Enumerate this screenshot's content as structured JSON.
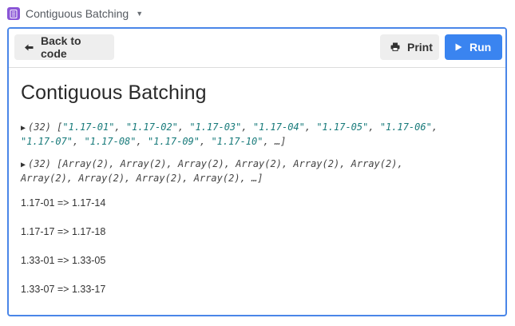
{
  "window": {
    "title": "Contiguous Batching",
    "accent": "#8a55d6"
  },
  "toolbar": {
    "back_label": "Back to code",
    "print_label": "Print",
    "run_label": "Run",
    "run_color": "#3a84f0"
  },
  "page": {
    "title": "Contiguous Batching"
  },
  "outputs": [
    {
      "count": "(32)",
      "items": [
        "\"1.17-01\"",
        "\"1.17-02\"",
        "\"1.17-03\"",
        "\"1.17-04\"",
        "\"1.17-05\"",
        "\"1.17-06\"",
        "\"1.17-07\"",
        "\"1.17-08\"",
        "\"1.17-09\"",
        "\"1.17-10\""
      ],
      "ellipsis": "…"
    },
    {
      "count": "(32)",
      "items": [
        "Array(2)",
        "Array(2)",
        "Array(2)",
        "Array(2)",
        "Array(2)",
        "Array(2)",
        "Array(2)",
        "Array(2)",
        "Array(2)",
        "Array(2)"
      ],
      "ellipsis": "…"
    }
  ],
  "results": [
    "1.17-01 => 1.17-14",
    "1.17-17 => 1.17-18",
    "1.33-01 => 1.33-05",
    "1.33-07 => 1.33-17"
  ]
}
